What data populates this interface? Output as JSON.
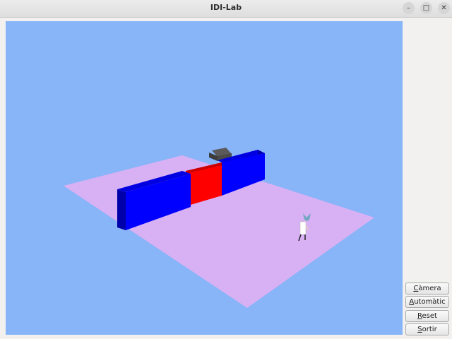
{
  "window": {
    "title": "IDI-Lab",
    "controls": [
      "minimize-icon",
      "maximize-icon",
      "close-icon"
    ]
  },
  "scene": {
    "background_color": "#88b4f8",
    "floor_color": "#d8b0f4",
    "wall_color": "#0000ff",
    "door_color": "#ff0000",
    "objects": [
      "floor",
      "left-wall",
      "red-door",
      "right-wall",
      "camera-model",
      "patrick-character"
    ]
  },
  "buttons": [
    {
      "id": "camera",
      "mnemonic": "C",
      "rest": "àmera"
    },
    {
      "id": "automatic",
      "mnemonic": "A",
      "rest": "utomàtic"
    },
    {
      "id": "reset",
      "mnemonic": "R",
      "rest": "eset"
    },
    {
      "id": "exit",
      "mnemonic": "S",
      "rest": "ortir"
    }
  ]
}
